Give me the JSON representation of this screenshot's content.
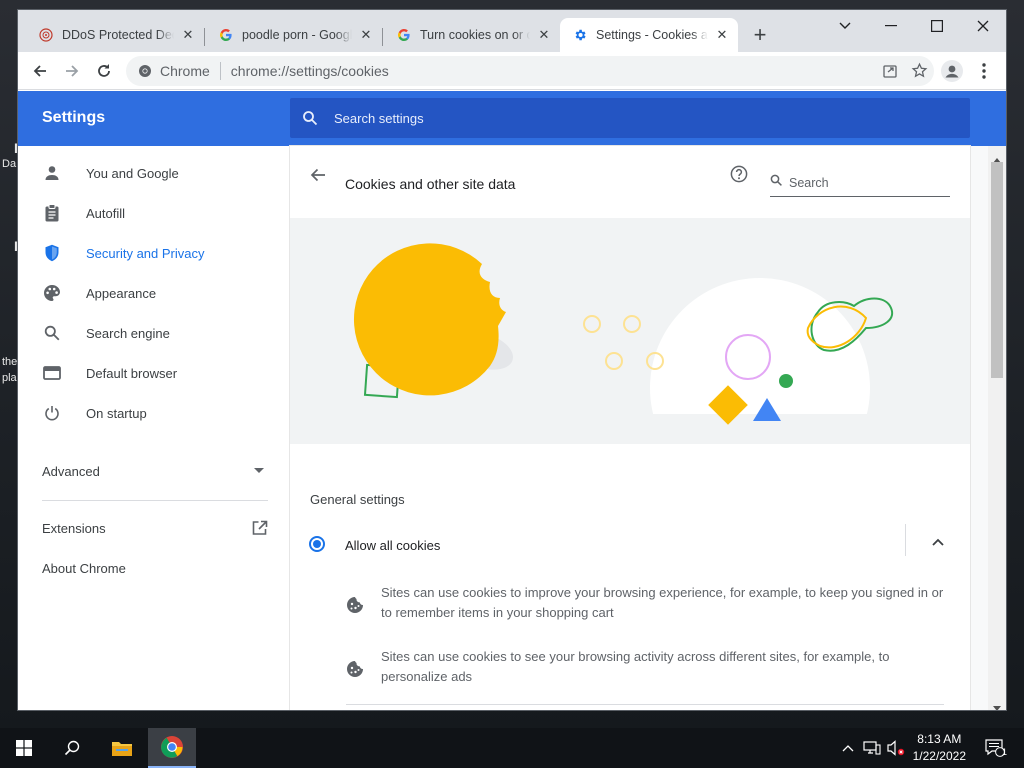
{
  "desktop": {
    "frag1": "I",
    "frag2": "Da",
    "frag3": "I",
    "frag4": "the",
    "frag5": "pla"
  },
  "tabs": [
    {
      "title": "DDoS Protected Dedi",
      "favicon": "ddos-site-icon"
    },
    {
      "title": "poodle porn - Google",
      "favicon": "google-g-icon"
    },
    {
      "title": "Turn cookies on or of",
      "favicon": "google-g-icon"
    },
    {
      "title": "Settings - Cookies an",
      "favicon": "settings-gear-icon",
      "active": true
    }
  ],
  "omnibox": {
    "site": "Chrome",
    "url_scheme": "chrome://",
    "url_rest": "settings/cookies"
  },
  "settings": {
    "title": "Settings",
    "search_placeholder": "Search settings"
  },
  "sidebar": {
    "items": [
      {
        "label": "You and Google",
        "icon": "person-icon"
      },
      {
        "label": "Autofill",
        "icon": "clipboard-icon"
      },
      {
        "label": "Security and Privacy",
        "icon": "shield-icon",
        "active": true
      },
      {
        "label": "Appearance",
        "icon": "palette-icon"
      },
      {
        "label": "Search engine",
        "icon": "search-icon"
      },
      {
        "label": "Default browser",
        "icon": "browser-window-icon"
      },
      {
        "label": "On startup",
        "icon": "power-icon"
      }
    ],
    "advanced": "Advanced",
    "extensions": "Extensions",
    "about": "About Chrome"
  },
  "page": {
    "title": "Cookies and other site data",
    "search_placeholder": "Search",
    "general_settings": "General settings",
    "allow_all": "Allow all cookies",
    "desc1": "Sites can use cookies to improve your browsing experience, for example, to keep you signed in or to remember items in your shopping cart",
    "desc2": "Sites can use cookies to see your browsing activity across different sites, for example, to personalize ads"
  },
  "taskbar": {
    "time": "8:13 AM",
    "date": "1/22/2022",
    "notifications": "1"
  },
  "colors": {
    "accent": "#1a73e8",
    "header": "#2f6ee0",
    "cookie": "#fbbc04"
  }
}
